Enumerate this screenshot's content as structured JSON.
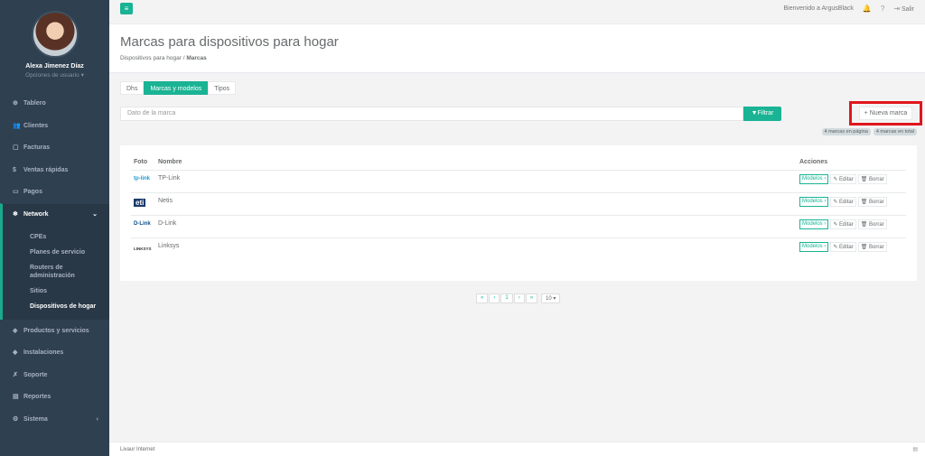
{
  "profile": {
    "name": "Alexa Jimenez Díaz",
    "menu_label": "Opciones de usuario ▾"
  },
  "sidebar": {
    "items": [
      {
        "icon": "dashboard-icon",
        "glyph": "⊕",
        "label": "Tablero"
      },
      {
        "icon": "users-icon",
        "glyph": "👥",
        "label": "Clientes"
      },
      {
        "icon": "file-icon",
        "glyph": "▢",
        "label": "Facturas"
      },
      {
        "icon": "dollar-icon",
        "glyph": "$",
        "label": "Ventas rápidas"
      },
      {
        "icon": "money-icon",
        "glyph": "▭",
        "label": "Pagos"
      },
      {
        "icon": "network-icon",
        "glyph": "❄",
        "label": "Network"
      }
    ],
    "network_sub": [
      "CPEs",
      "Planes de servicio",
      "Routers de administración",
      "Sitios",
      "Dispositivos de hogar"
    ],
    "bottom_items": [
      {
        "icon": "tag-icon",
        "glyph": "◈",
        "label": "Productos y servicios"
      },
      {
        "icon": "installations-icon",
        "glyph": "◆",
        "label": "Instalaciones"
      },
      {
        "icon": "wrench-icon",
        "glyph": "✗",
        "label": "Soporte"
      },
      {
        "icon": "reports-icon",
        "glyph": "▤",
        "label": "Reportes"
      },
      {
        "icon": "cogs-icon",
        "glyph": "⚙",
        "label": "Sistema"
      }
    ]
  },
  "topbar": {
    "welcome": "Bienvenido a ArgusBlack",
    "logout": "Salir",
    "bell_glyph": "🔔",
    "help_glyph": "?",
    "logout_glyph": "⇥"
  },
  "heading": {
    "title": "Marcas para dispositivos para hogar",
    "crumb_parent": "Dispositivos para hogar",
    "crumb_sep": "/",
    "crumb_current": "Marcas"
  },
  "tabs": [
    "Dhs",
    "Marcas y modelos",
    "Tipos"
  ],
  "filter": {
    "placeholder": "Dato de la marca",
    "button": "▼Filtrar"
  },
  "new_brand": "+ Nueva marca",
  "badges": [
    "4 marcas en página",
    "4 marcas en total"
  ],
  "table": {
    "headers": {
      "foto": "Foto",
      "nombre": "Nombre",
      "acciones": "Acciones"
    },
    "rows": [
      {
        "logo": "tp-link",
        "name": "TP-Link"
      },
      {
        "logo": "eti",
        "name": "Netis"
      },
      {
        "logo": "D-Link",
        "name": "D-Link"
      },
      {
        "logo": "LINKSYS",
        "name": "Linksys"
      }
    ],
    "actions": {
      "models": "Modelos ›",
      "edit": "✎ Editar",
      "delete": "🗑 Borrar"
    }
  },
  "pager": {
    "first": "«",
    "prev": "‹",
    "current": "1",
    "next": "›",
    "last": "»",
    "per_page": "10 ▾"
  },
  "footer": {
    "text": "Livaur Internet"
  }
}
